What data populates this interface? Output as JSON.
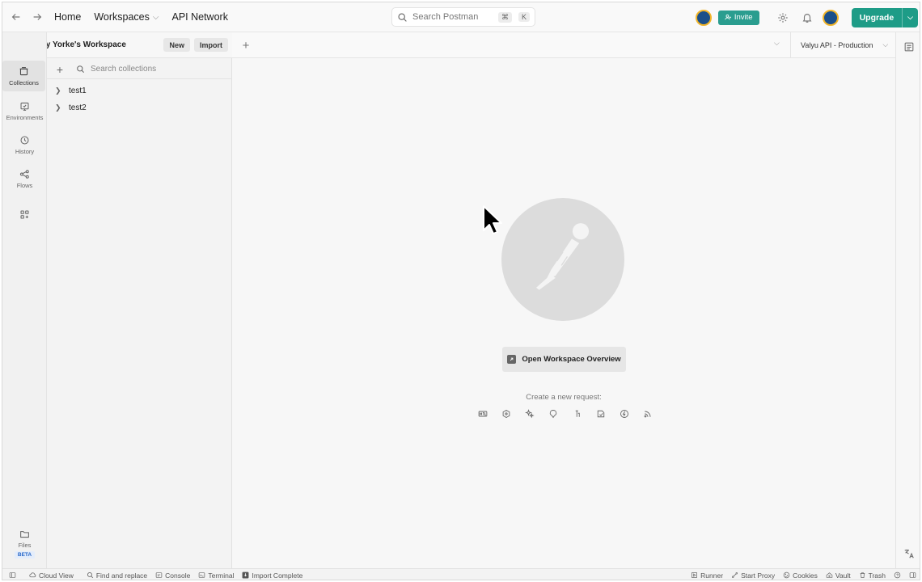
{
  "header": {
    "home": "Home",
    "workspaces": "Workspaces",
    "api_network": "API Network",
    "search_placeholder": "Search Postman",
    "shortcut_mod": "⌘",
    "shortcut_key": "K",
    "invite": "Invite",
    "upgrade": "Upgrade"
  },
  "workspace": {
    "name": "Harvey Yorke's Workspace",
    "new_label": "New",
    "import_label": "Import"
  },
  "rail": {
    "items": [
      {
        "label": "Collections",
        "icon": "collections-icon"
      },
      {
        "label": "Environments",
        "icon": "environments-icon"
      },
      {
        "label": "History",
        "icon": "history-icon"
      },
      {
        "label": "Flows",
        "icon": "flows-icon"
      }
    ],
    "files_label": "Files",
    "beta": "BETA"
  },
  "sidebar": {
    "search_placeholder": "Search collections",
    "collections": [
      "test1",
      "test2"
    ]
  },
  "env": {
    "selected": "Valyu API - Production"
  },
  "main": {
    "overview_button": "Open Workspace Overview",
    "create_request_label": "Create a new request:",
    "request_types": [
      "http-icon",
      "graphql-icon",
      "ai-icon",
      "grpc-icon",
      "websocket-icon",
      "socketio-icon",
      "mqtt-icon",
      "sse-icon"
    ]
  },
  "status": {
    "cloud_view": "Cloud View",
    "find_replace": "Find and replace",
    "console": "Console",
    "terminal": "Terminal",
    "import_complete": "Import Complete",
    "runner": "Runner",
    "start_proxy": "Start Proxy",
    "cookies": "Cookies",
    "vault": "Vault",
    "trash": "Trash"
  },
  "colors": {
    "accent": "#1e9c87",
    "invite": "#2a9d8f"
  }
}
